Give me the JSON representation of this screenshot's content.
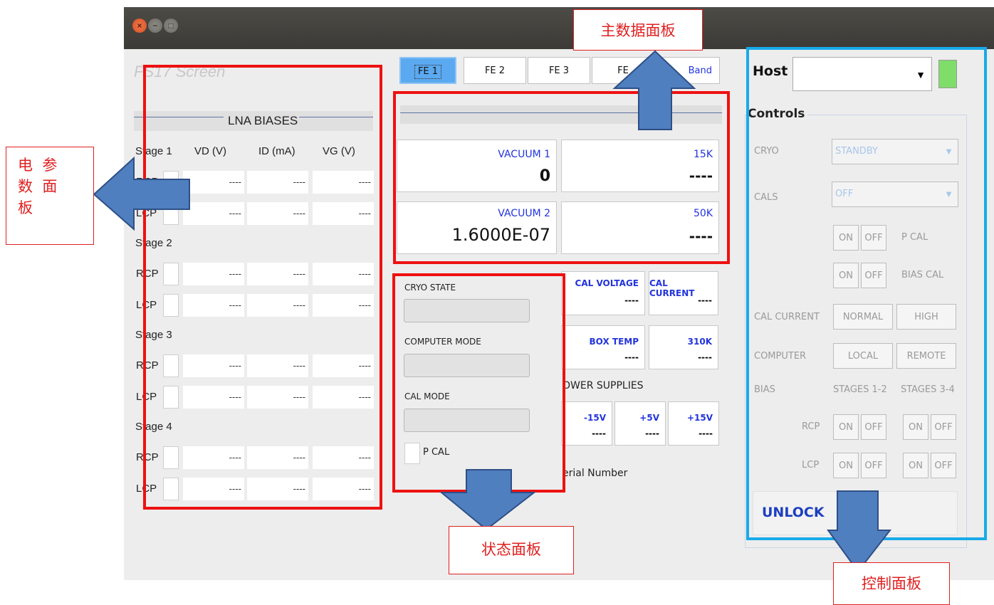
{
  "window": {
    "close_glyph": "×",
    "min_glyph": "−",
    "max_glyph": "□",
    "ghost_title": "FS17 Screen"
  },
  "lna": {
    "title": "LNA BIASES",
    "col_vd": "VD (V)",
    "col_id": "ID (mA)",
    "col_vg": "VG (V)",
    "stages": [
      {
        "label": "Stage 1",
        "rows": [
          {
            "pol": "RCP",
            "vd": "----",
            "id": "----",
            "vg": "----"
          },
          {
            "pol": "LCP",
            "vd": "----",
            "id": "----",
            "vg": "----"
          }
        ]
      },
      {
        "label": "Stage 2",
        "rows": [
          {
            "pol": "RCP",
            "vd": "----",
            "id": "----",
            "vg": "----"
          },
          {
            "pol": "LCP",
            "vd": "----",
            "id": "----",
            "vg": "----"
          }
        ]
      },
      {
        "label": "Stage 3",
        "rows": [
          {
            "pol": "RCP",
            "vd": "----",
            "id": "----",
            "vg": "----"
          },
          {
            "pol": "LCP",
            "vd": "----",
            "id": "----",
            "vg": "----"
          }
        ]
      },
      {
        "label": "Stage 4",
        "rows": [
          {
            "pol": "RCP",
            "vd": "----",
            "id": "----",
            "vg": "----"
          },
          {
            "pol": "LCP",
            "vd": "----",
            "id": "----",
            "vg": "----"
          }
        ]
      }
    ]
  },
  "tabs": [
    "FE 1",
    "FE 2",
    "FE 3",
    "FE",
    "Band"
  ],
  "main": {
    "vacuum1_label": "VACUUM 1",
    "vacuum1_value": "0",
    "k15_label": "15K",
    "k15_value": "----",
    "vacuum2_label": "VACUUM 2",
    "vacuum2_value": "1.6000E-07",
    "k50_label": "50K",
    "k50_value": "----"
  },
  "status": {
    "cryo_state": "CRYO STATE",
    "computer_mode": "COMPUTER MODE",
    "cal_mode": "CAL MODE",
    "pcal": "P CAL"
  },
  "readings": {
    "cal_voltage_label": "CAL VOLTAGE",
    "cal_voltage_value": "----",
    "cal_current_label": "CAL CURRENT",
    "cal_current_value": "----",
    "box_temp_label": "BOX TEMP",
    "box_temp_value": "----",
    "k310_label": "310K",
    "k310_value": "----",
    "power_supplies": "OWER SUPPLIES",
    "m15_label": "-15V",
    "m15_value": "----",
    "p5_label": "+5V",
    "p5_value": "----",
    "p15_label": "+15V",
    "p15_value": "----",
    "serial": "erial Number"
  },
  "controls": {
    "host_label": "Host",
    "host_value": "",
    "title": "Controls",
    "cryo_label": "CRYO",
    "cryo_value": "STANDBY",
    "cals_label": "CALS",
    "cals_value": "OFF",
    "on": "ON",
    "off": "OFF",
    "pcal": "P CAL",
    "biascal": "BIAS CAL",
    "cal_current": "CAL CURRENT",
    "normal": "NORMAL",
    "high": "HIGH",
    "computer": "COMPUTER",
    "local": "LOCAL",
    "remote": "REMOTE",
    "bias": "BIAS",
    "stages12": "STAGES 1-2",
    "stages34": "STAGES 3-4",
    "rcp": "RCP",
    "lcp": "LCP",
    "unlock": "UNLOCK",
    "indicator_color": "#7fdd6a"
  },
  "annotations": {
    "main_panel": "主数据面板",
    "elec_panel_line1": "电  参",
    "elec_panel_line2": "数  面",
    "elec_panel_line3": "板",
    "status_panel": "状态面板",
    "control_panel": "控制面板",
    "red": "#ee1111",
    "blue": "#19aaea",
    "arrow": "#4f7fbf"
  }
}
